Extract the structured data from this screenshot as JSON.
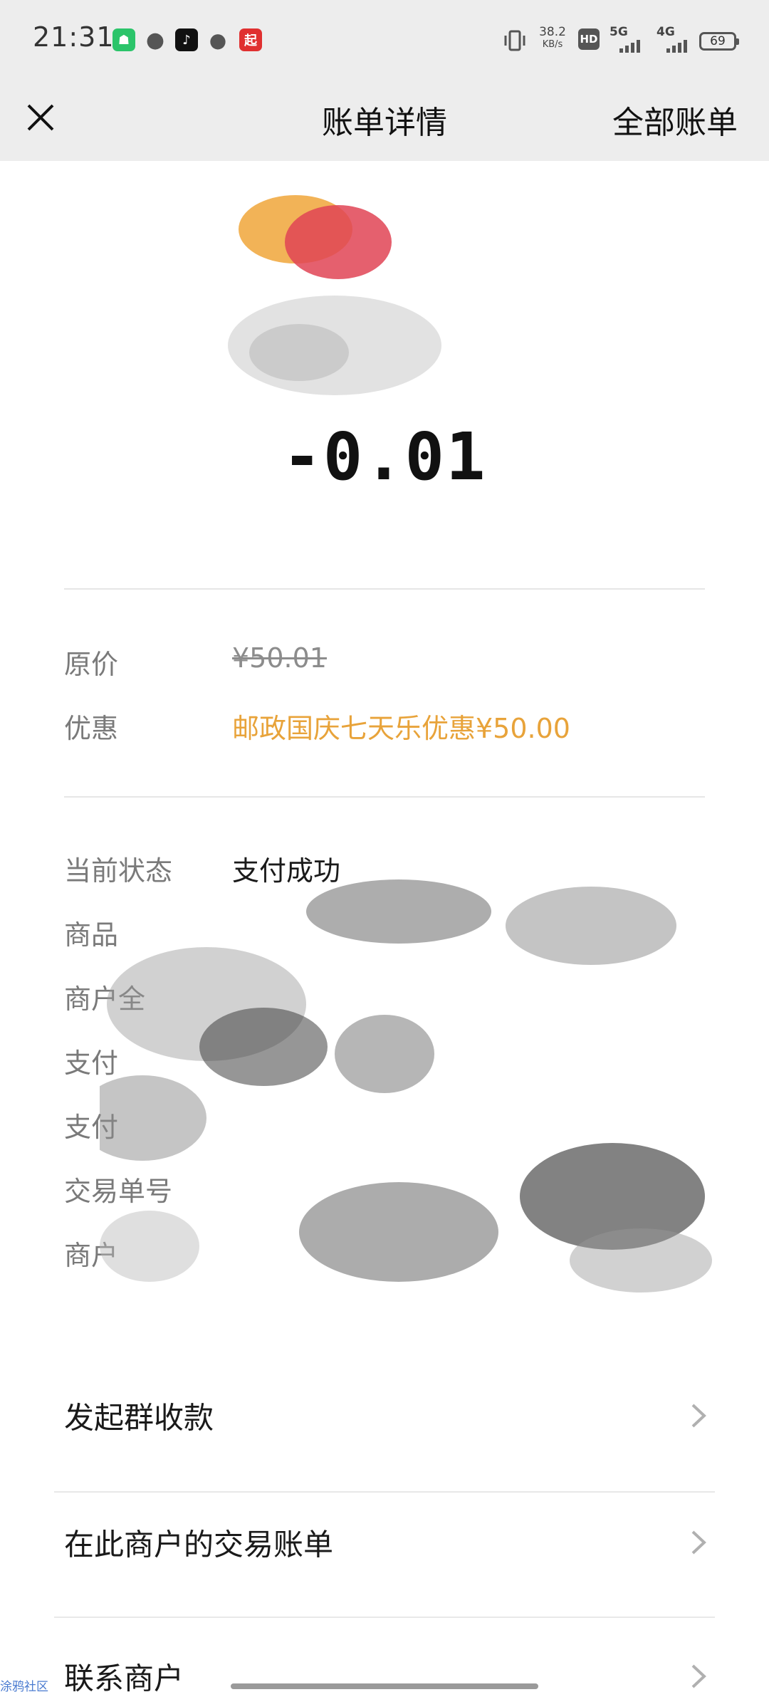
{
  "status_bar": {
    "time": "21:31",
    "speed_value": "38.2",
    "speed_unit": "KB/s",
    "hd_label": "HD",
    "net1": "5G",
    "net2": "4G",
    "battery": "69",
    "app_icons": [
      "messages-green-icon",
      "chat-bubble-icon",
      "douyin-icon",
      "bulb-icon",
      "qi-red-icon"
    ]
  },
  "header": {
    "title": "账单详情",
    "right_link": "全部账单"
  },
  "amount": "-0.01",
  "price_section": {
    "original_label": "原价",
    "original_value": "¥50.01",
    "discount_label": "优惠",
    "discount_value": "邮政国庆七天乐优惠¥50.00"
  },
  "details": {
    "status_label": "当前状态",
    "status_value": "支付成功",
    "product_label": "商品",
    "merchant_full_label": "商户全",
    "pay_time_label": "支付",
    "pay_method_label": "支付",
    "order_no_label": "交易单号",
    "merchant_no_label": "商户"
  },
  "actions": {
    "group_collect": "发起群收款",
    "merchant_bills": "在此商户的交易账单",
    "contact_merchant": "联系商户"
  },
  "watermark": "涂鸦社区",
  "colors": {
    "promo": "#e8a33a",
    "header_bg": "#ededed"
  }
}
